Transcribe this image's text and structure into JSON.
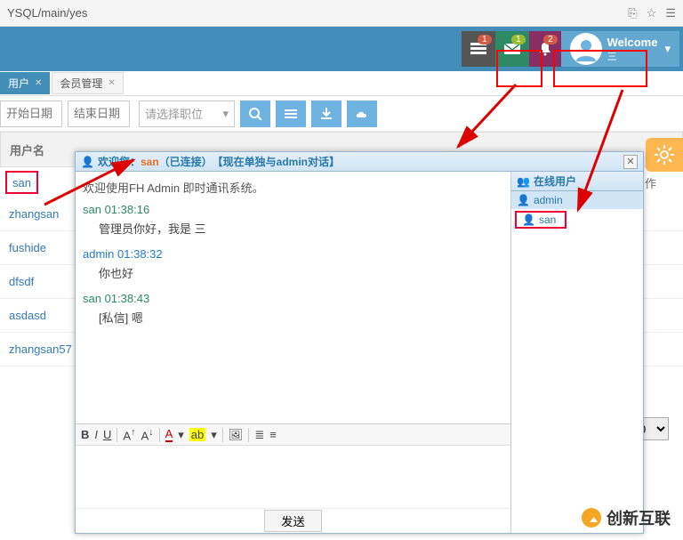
{
  "browser": {
    "url": "YSQL/main/yes"
  },
  "header": {
    "badge_dark": "1",
    "badge_mail": "1",
    "badge_bell": "2",
    "welcome": "Welcome",
    "welcome_sub": "三"
  },
  "tabs": [
    {
      "label": "用户",
      "active": true
    },
    {
      "label": "会员管理",
      "active": false
    }
  ],
  "toolbar": {
    "start_date_ph": "开始日期",
    "end_date_ph": "结束日期",
    "select_ph": "请选择职位"
  },
  "table": {
    "col_user": "用户名",
    "col_op": "作"
  },
  "users": [
    "san",
    "zhangsan",
    "fushide",
    "dfsdf",
    "asdasd",
    "zhangsan57"
  ],
  "dialog": {
    "title_prefix": "欢迎您：",
    "title_user": "san",
    "title_status": "（已连接）",
    "title_suffix": "【现在单独与admin对话】",
    "sys_line": "欢迎使用FH Admin 即时通讯系统。",
    "lines": [
      {
        "meta": "san 01:38:16",
        "other": false,
        "msg": "管理员你好，我是 三"
      },
      {
        "meta": "admin 01:38:32",
        "other": true,
        "msg": "你也好"
      },
      {
        "meta": "san 01:38:43",
        "other": false,
        "msg": "[私信] 嗯"
      }
    ],
    "send": "发送"
  },
  "online": {
    "title": "在线用户",
    "users": [
      "admin",
      "san"
    ]
  },
  "zero": "0",
  "watermark": "创新互联"
}
